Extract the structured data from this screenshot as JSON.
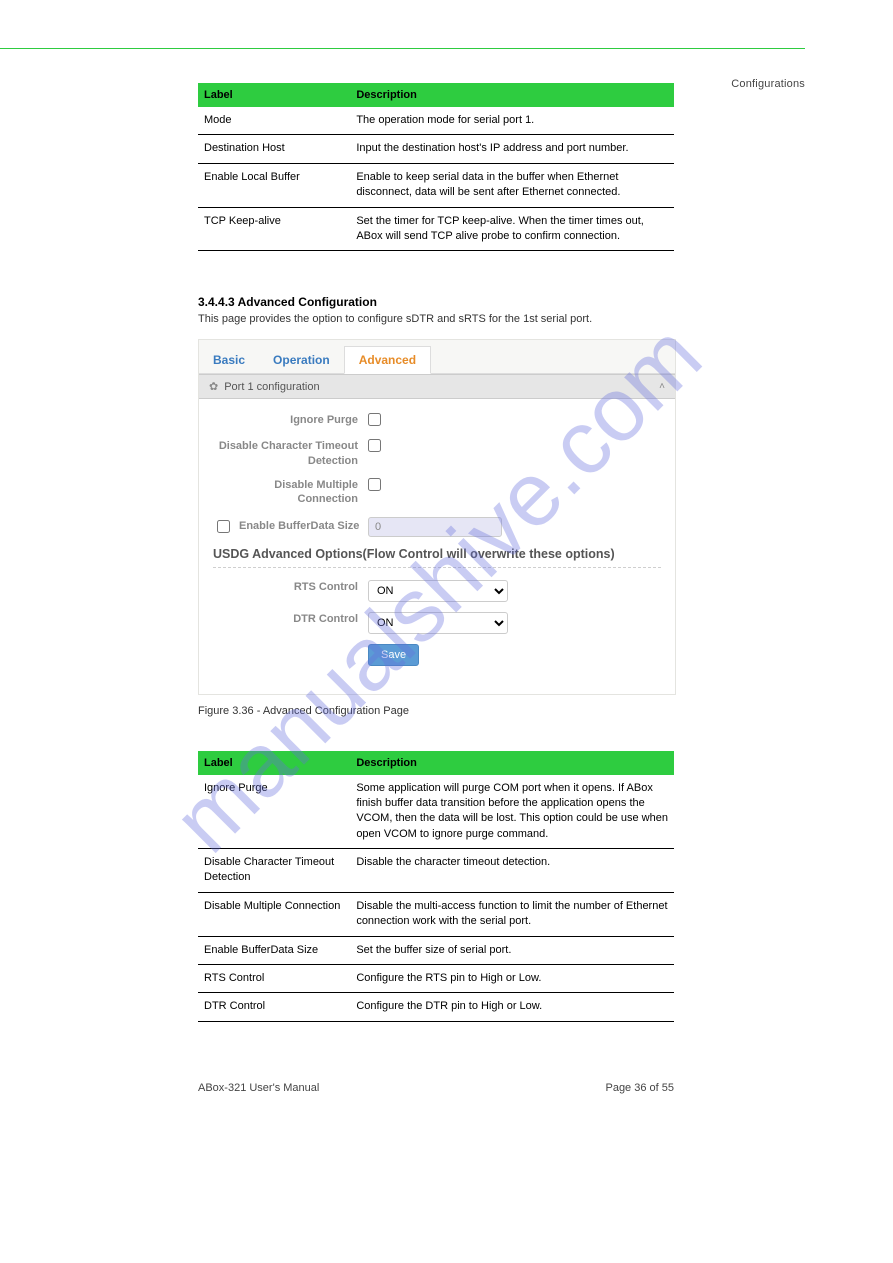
{
  "header_right": "Configurations",
  "table1": {
    "headers": [
      "Label",
      "Description"
    ],
    "rows": [
      [
        "Mode",
        "The operation mode for serial port 1."
      ],
      [
        "Destination Host",
        "Input the destination host's IP address and port number."
      ],
      [
        "Enable Local Buffer",
        "Enable to keep serial data in the buffer when Ethernet disconnect, data will be sent after Ethernet connected."
      ],
      [
        "TCP Keep-alive",
        "Set the timer for TCP keep-alive. When the timer times out, ABox will send TCP alive probe to confirm connection."
      ]
    ]
  },
  "section": {
    "heading": "3.4.4.3 Advanced Configuration",
    "sub": "This page provides the option to configure sDTR and sRTS for the 1st serial port."
  },
  "ui": {
    "tabs": {
      "basic": "Basic",
      "operation": "Operation",
      "advanced": "Advanced"
    },
    "panel_title": "Port 1 configuration",
    "labels": {
      "ignore_purge": "Ignore Purge",
      "disable_char_timeout": "Disable Character Timeout Detection",
      "disable_multiple": "Disable Multiple Connection",
      "enable_buffer": "Enable BufferData Size",
      "buffer_value": "0",
      "usdg_title": "USDG Advanced Options(Flow Control will overwrite these options)",
      "rts": "RTS Control",
      "dtr": "DTR Control",
      "on": "ON",
      "save": "Save"
    }
  },
  "fig_caption": "Figure 3.36 - Advanced Configuration Page",
  "table2": {
    "headers": [
      "Label",
      "Description"
    ],
    "rows": [
      [
        "Ignore Purge",
        "Some application will purge COM port when it opens. If ABox finish buffer data transition before the application opens the VCOM, then the data will be lost. This option could be use when open VCOM to ignore purge command."
      ],
      [
        "Disable Character Timeout Detection",
        "Disable the character timeout detection."
      ],
      [
        "Disable Multiple Connection",
        "Disable the multi-access function to limit the number of Ethernet connection work with the serial port."
      ],
      [
        "Enable BufferData Size",
        "Set the buffer size of serial port."
      ],
      [
        "RTS Control",
        "Configure the RTS pin to High or Low."
      ],
      [
        "DTR Control",
        "Configure the DTR pin to High or Low."
      ]
    ]
  },
  "footer": {
    "left": "ABox-321 User's Manual",
    "right": "Page 36 of 55"
  },
  "watermark": "manualshive.com"
}
